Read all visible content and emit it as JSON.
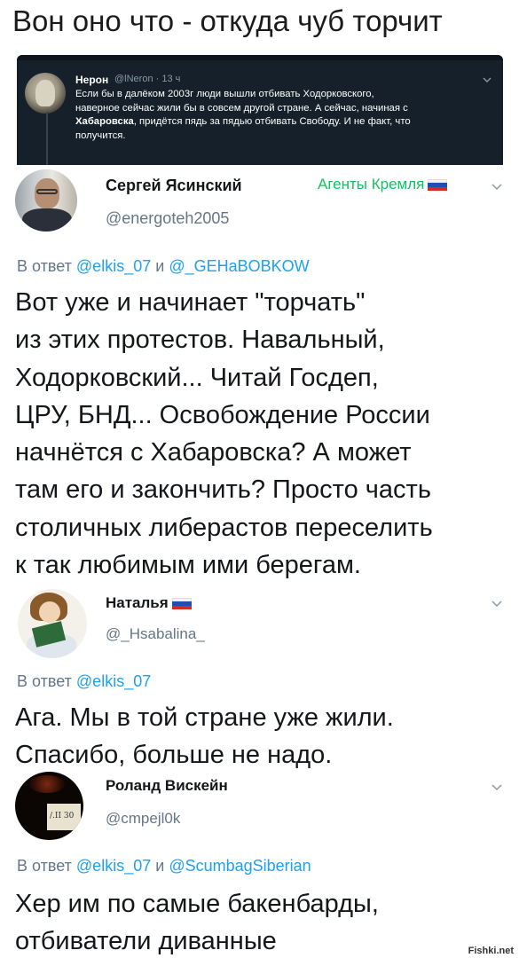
{
  "caption": "Вон оно что - откуда чуб торчит",
  "embedded_tweet": {
    "name": "Нерон",
    "handle_time": "@lNeron · 13 ч",
    "lines": [
      "Если бы в далёком 2003г люди вышли отбивать Ходорковского,",
      "наверное сейчас жили бы в совсем другой стране. А сейчас, начиная с",
      "пядь за пядью отбивать Свободу. И не факт, что",
      "получится."
    ],
    "bold_word": "Хабаровска",
    "bold_suffix": ", придётся",
    "theme_color": "#15202b"
  },
  "tweets": [
    {
      "name": "Сергей Ясинский",
      "handle": "@energoteh2005",
      "badge": "Агенты Кремля",
      "reply_prefix": "В ответ",
      "reply_link1": "@elkis_07",
      "reply_and": "и",
      "reply_link2": "@_GEHaBOBKOW",
      "lines": [
        "Вот уже и начинает \"торчать\"",
        "из этих протестов. Навальный,",
        "Ходорковский... Читай Госдеп,",
        "ЦРУ, БНД... Освобождение России",
        "начнётся с Хабаровска? А может",
        "там его и закончить? Просто часть",
        "столичных либерастов переселить",
        "к так любимым ими берегам."
      ]
    },
    {
      "name": "Наталья",
      "handle": "@_Hsabalina_",
      "reply_prefix": "В ответ",
      "reply_link1": "@elkis_07",
      "lines": [
        "Ага. Мы в той стране уже жили.",
        "Спасибо, больше не надо."
      ]
    },
    {
      "name": "Роланд Вискейн",
      "handle": "@cmpejl0k",
      "reply_prefix": "В ответ",
      "reply_link1": "@elkis_07",
      "reply_and": "и",
      "reply_link2": "@ScumbagSiberian",
      "avatar_text": "/.II 30",
      "lines": [
        "Хер им по самые бакенбарды,",
        "отбиватели диванные"
      ]
    }
  ],
  "watermark": "Fishki.net",
  "colors": {
    "link": "#1da1f2",
    "secondary_text": "#657786",
    "badge": "#17bf63"
  },
  "icons": [
    "chevron-down-icon",
    "russia-flag-icon"
  ]
}
